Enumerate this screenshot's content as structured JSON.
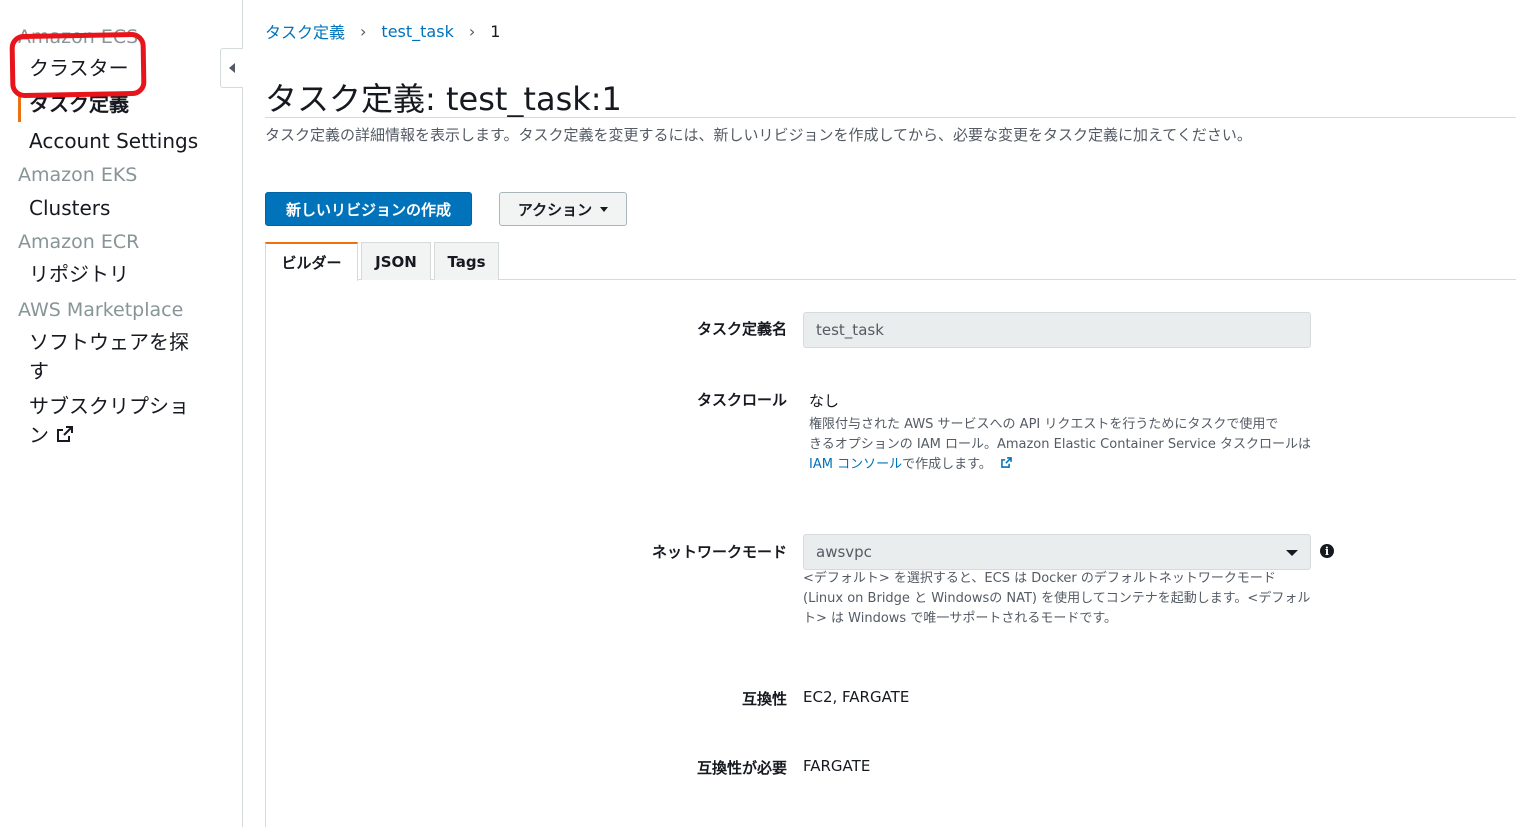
{
  "sidebar": {
    "sections": [
      {
        "title": "Amazon ECS",
        "items": [
          "クラスター",
          "タスク定義",
          "Account Settings"
        ]
      },
      {
        "title": "Amazon EKS",
        "items": [
          "Clusters"
        ]
      },
      {
        "title": "Amazon ECR",
        "items": [
          "リポジトリ"
        ]
      },
      {
        "title": "AWS Marketplace",
        "items": [
          "ソフトウェアを探す",
          "サブスクリプション"
        ]
      }
    ],
    "active_item": "タスク定義",
    "marketplace_item1_line1": "ソフトウェアを探",
    "marketplace_item1_line2": "す",
    "marketplace_item2_line1": "サブスクリプショ",
    "marketplace_item2_line2": "ン"
  },
  "breadcrumb": {
    "root": "タスク定義",
    "task": "test_task",
    "revision": "1"
  },
  "page": {
    "title": "タスク定義: test_task:1",
    "subtitle": "タスク定義の詳細情報を表示します。タスク定義を変更するには、新しいリビジョンを作成してから、必要な変更をタスク定義に加えてください。"
  },
  "buttons": {
    "create_revision": "新しいリビジョンの作成",
    "actions": "アクション"
  },
  "tabs": [
    {
      "label": "ビルダー",
      "active": true
    },
    {
      "label": "JSON",
      "active": false
    },
    {
      "label": "Tags",
      "active": false
    }
  ],
  "form": {
    "task_def_name": {
      "label": "タスク定義名",
      "value": "test_task"
    },
    "task_role": {
      "label": "タスクロール",
      "value": "なし",
      "help_line1": "権限付与された AWS サービスへの API リクエストを行うためにタスクで使用で",
      "help_line2": "きるオプションの IAM ロール。Amazon Elastic Container Service タスクロールは",
      "help_link": "IAM コンソール",
      "help_line3_suffix": "で作成します。"
    },
    "network_mode": {
      "label": "ネットワークモード",
      "value": "awsvpc",
      "help_line1": "<デフォルト> を選択すると、ECS は Docker のデフォルトネットワークモード",
      "help_line2": "(Linux on Bridge と Windowsの NAT) を使用してコンテナを起動します。<デフォル",
      "help_line3": "ト> は Windows で唯一サポートされるモードです。"
    },
    "compatibility": {
      "label": "互換性",
      "value": "EC2, FARGATE"
    },
    "requires_compat": {
      "label": "互換性が必要",
      "value": "FARGATE"
    }
  },
  "colors": {
    "link": "#0073bb",
    "primary_button": "#0073bb",
    "active_accent": "#ec7211",
    "annotation": "#e8141b"
  }
}
